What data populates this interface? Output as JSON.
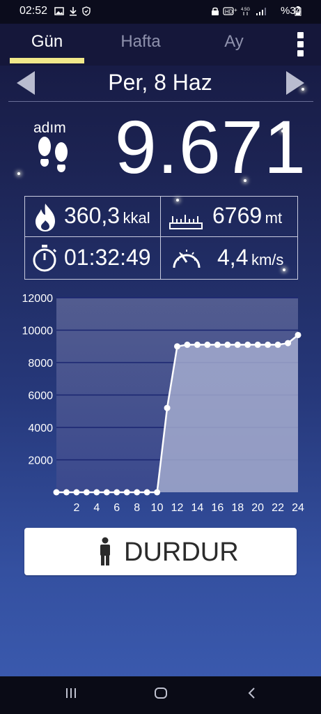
{
  "status_bar": {
    "time": "02:52",
    "battery": "%34",
    "icons": [
      "gallery-icon",
      "download-icon",
      "shield-icon",
      "lock-icon",
      "hd-signal-icon",
      "4g-icon",
      "signal-bars-icon",
      "battery-icon"
    ]
  },
  "tabs": [
    {
      "label": "Gün",
      "active": true
    },
    {
      "label": "Hafta",
      "active": false
    },
    {
      "label": "Ay",
      "active": false
    }
  ],
  "date": "Per, 8 Haz",
  "steps": {
    "label": "adım",
    "value": "9.671"
  },
  "stats": {
    "calories_value": "360,3",
    "calories_unit": "kkal",
    "distance_value": "6769",
    "distance_unit": "mt",
    "duration_value": "01:32:49",
    "speed_value": "4,4",
    "speed_unit": "km/s"
  },
  "colors": {
    "accent_underline": "#f1e88a",
    "chart_fill": "#a9b0d2",
    "chart_line": "#ffffff",
    "background_top": "#15173d",
    "background_bottom": "#3a59ad"
  },
  "chart_data": {
    "type": "area",
    "x": [
      0,
      1,
      2,
      3,
      4,
      5,
      6,
      7,
      8,
      9,
      10,
      11,
      12,
      13,
      14,
      15,
      16,
      17,
      18,
      19,
      20,
      21,
      22,
      23,
      24
    ],
    "values": [
      0,
      0,
      0,
      0,
      0,
      0,
      0,
      0,
      0,
      0,
      0,
      5200,
      9000,
      9100,
      9100,
      9100,
      9100,
      9100,
      9100,
      9100,
      9100,
      9100,
      9100,
      9200,
      9700
    ],
    "xticks": [
      "2",
      "4",
      "6",
      "8",
      "10",
      "12",
      "14",
      "16",
      "18",
      "20",
      "22",
      "24"
    ],
    "yticks": [
      "2000",
      "4000",
      "6000",
      "8000",
      "10000",
      "12000"
    ],
    "xlim": [
      0,
      24
    ],
    "ylim": [
      0,
      12000
    ],
    "grid": true
  },
  "button": {
    "label": "DURDUR"
  }
}
